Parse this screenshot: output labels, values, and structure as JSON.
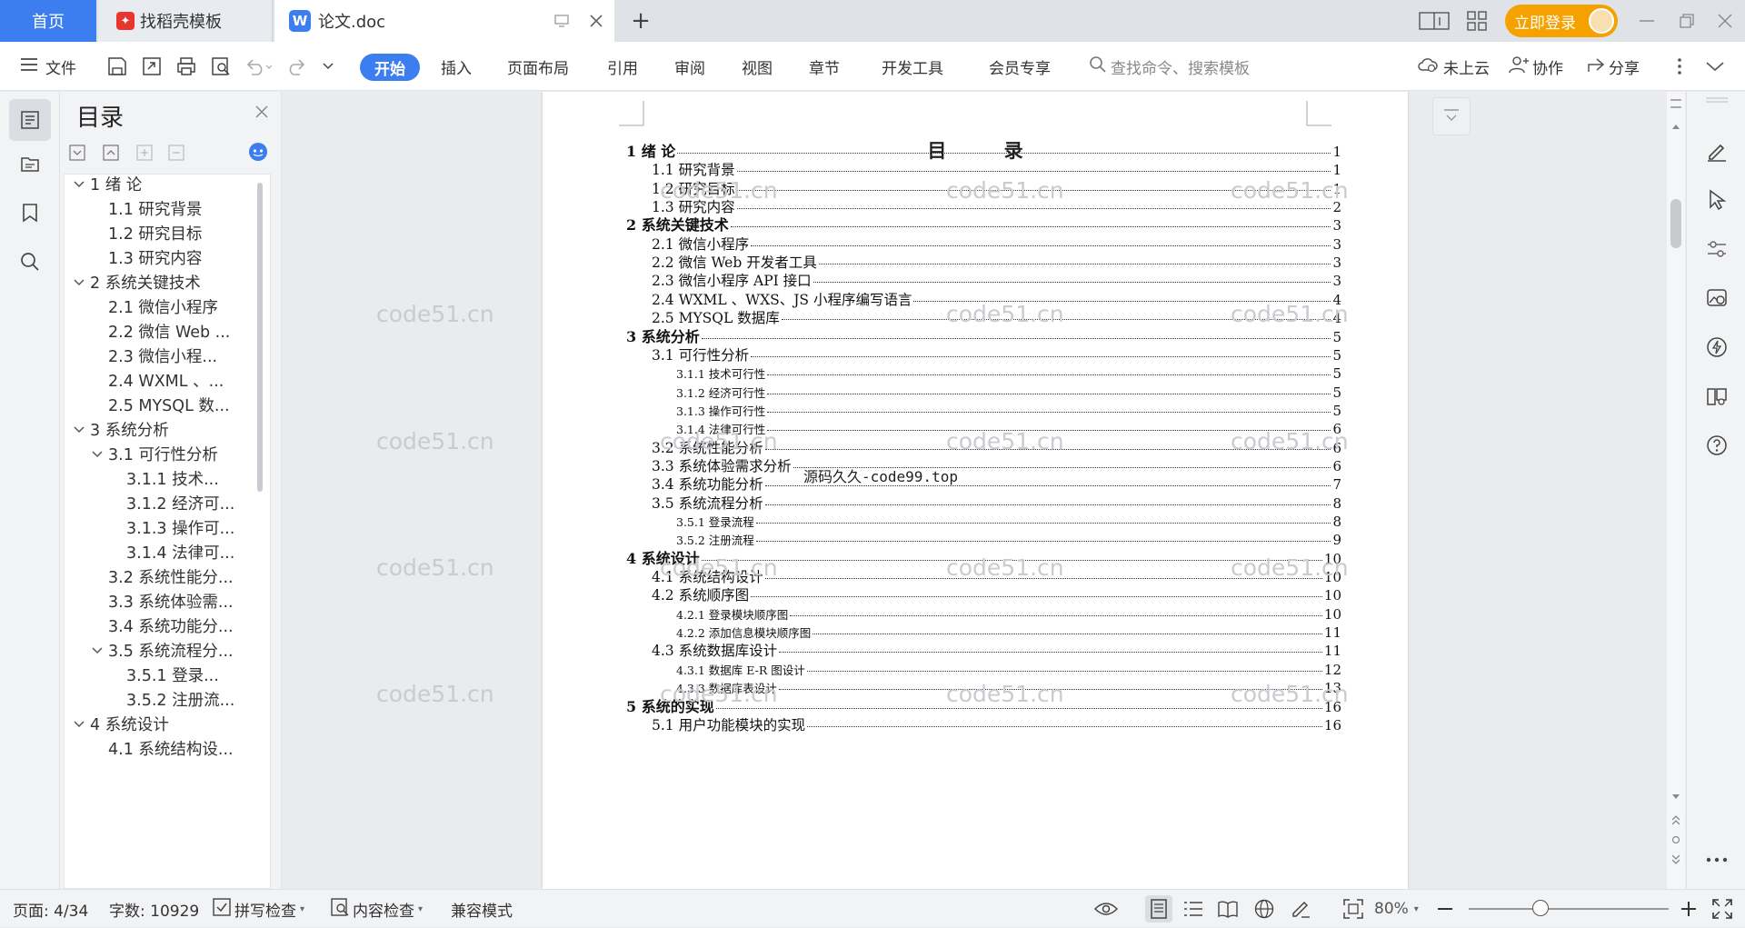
{
  "tabs": {
    "home": "首页",
    "template": "找稻壳模板",
    "document": "论文.doc",
    "new_tab": "+"
  },
  "header": {
    "login": "立即登录"
  },
  "ribbon": {
    "file": "文件",
    "tabs": [
      "开始",
      "插入",
      "页面布局",
      "引用",
      "审阅",
      "视图",
      "章节",
      "开发工具",
      "会员专享"
    ],
    "search_placeholder": "查找命令、搜索模板",
    "cloud": "未上云",
    "collab": "协作",
    "share": "分享"
  },
  "nav_panel": {
    "title": "目录",
    "items": [
      {
        "label": "1 绪 论",
        "level": 1,
        "expanded": true
      },
      {
        "label": "1.1 研究背景",
        "level": 2
      },
      {
        "label": "1.2 研究目标",
        "level": 2
      },
      {
        "label": "1.3 研究内容",
        "level": 2
      },
      {
        "label": "2 系统关键技术",
        "level": 1,
        "expanded": true
      },
      {
        "label": "2.1  微信小程序",
        "level": 2
      },
      {
        "label": "2.2  微信 Web ...",
        "level": 2
      },
      {
        "label": "2.3  微信小程...",
        "level": 2
      },
      {
        "label": "2.4 WXML 、...",
        "level": 2
      },
      {
        "label": "2.5 MYSQL 数...",
        "level": 2
      },
      {
        "label": "3 系统分析",
        "level": 1,
        "expanded": true
      },
      {
        "label": "3.1 可行性分析",
        "level": 2,
        "expanded": true
      },
      {
        "label": "3.1.1  技术...",
        "level": 3
      },
      {
        "label": "3.1.2 经济可...",
        "level": 3
      },
      {
        "label": "3.1.3 操作可...",
        "level": 3
      },
      {
        "label": "3.1.4 法律可...",
        "level": 3
      },
      {
        "label": "3.2 系统性能分...",
        "level": 2
      },
      {
        "label": "3.3  系统体验需...",
        "level": 2
      },
      {
        "label": "3.4  系统功能分...",
        "level": 2
      },
      {
        "label": "3.5 系统流程分...",
        "level": 2,
        "expanded": true
      },
      {
        "label": "3.5.1  登录...",
        "level": 3
      },
      {
        "label": "3.5.2 注册流...",
        "level": 3
      },
      {
        "label": "4 系统设计",
        "level": 1,
        "expanded": true
      },
      {
        "label": "4.1 系统结构设...",
        "level": 2
      }
    ]
  },
  "document": {
    "title": "目 录",
    "toc": [
      {
        "text": "1 绪 论",
        "page": "1",
        "level": 1
      },
      {
        "text": "1.1 研究背景",
        "page": "1",
        "level": 2
      },
      {
        "text": "1.2 研究目标",
        "page": "1",
        "level": 2
      },
      {
        "text": "1.3 研究内容",
        "page": "2",
        "level": 2
      },
      {
        "text": "2 系统关键技术",
        "page": "3",
        "level": 1
      },
      {
        "text": "2.1  微信小程序",
        "page": "3",
        "level": 2
      },
      {
        "text": "2.2  微信 Web 开发者工具",
        "page": "3",
        "level": 2
      },
      {
        "text": "2.3  微信小程序 API 接口",
        "page": "3",
        "level": 2
      },
      {
        "text": "2.4  WXML 、WXS、JS 小程序编写语言",
        "page": "4",
        "level": 2
      },
      {
        "text": "2.5  MYSQL 数据库",
        "page": "4",
        "level": 2
      },
      {
        "text": "3 系统分析",
        "page": "5",
        "level": 1
      },
      {
        "text": "3.1 可行性分析",
        "page": "5",
        "level": 2
      },
      {
        "text": "3.1.1  技术可行性",
        "page": "5",
        "level": 3
      },
      {
        "text": "3.1.2 经济可行性",
        "page": "5",
        "level": 3
      },
      {
        "text": "3.1.3 操作可行性",
        "page": "5",
        "level": 3
      },
      {
        "text": "3.1.4 法律可行性",
        "page": "6",
        "level": 3
      },
      {
        "text": "3.2 系统性能分析",
        "page": "6",
        "level": 2
      },
      {
        "text": "3.3  系统体验需求分析",
        "page": "6",
        "level": 2
      },
      {
        "text": "3.4  系统功能分析",
        "page": "7",
        "level": 2
      },
      {
        "text": "3.5 系统流程分析",
        "page": "8",
        "level": 2
      },
      {
        "text": "3.5.1  登录流程",
        "page": "8",
        "level": 3
      },
      {
        "text": "3.5.2 注册流程",
        "page": "9",
        "level": 3
      },
      {
        "text": "4 系统设计",
        "page": "10",
        "level": 1
      },
      {
        "text": "4.1 系统结构设计",
        "page": "10",
        "level": 2
      },
      {
        "text": "4.2 系统顺序图",
        "page": "10",
        "level": 2
      },
      {
        "text": "4.2.1 登录模块顺序图",
        "page": "10",
        "level": 3
      },
      {
        "text": "4.2.2 添加信息模块顺序图",
        "page": "11",
        "level": 3
      },
      {
        "text": "4.3 系统数据库设计",
        "page": "11",
        "level": 2
      },
      {
        "text": "4.3.1 数据库 E-R 图设计",
        "page": "12",
        "level": 3
      },
      {
        "text": "4.3.3 数据库表设计",
        "page": "13",
        "level": 3
      },
      {
        "text": "5  系统的实现",
        "page": "16",
        "level": 1
      },
      {
        "text": "5.1 用户功能模块的实现",
        "page": "16",
        "level": 2
      }
    ],
    "overlay": "源码久久-code99.top",
    "watermark": "code51.cn"
  },
  "status": {
    "page": "页面: 4/34",
    "words": "字数: 10929",
    "spell": "拼写检查",
    "content_check": "内容检查",
    "compat": "兼容模式",
    "zoom": "80%"
  }
}
